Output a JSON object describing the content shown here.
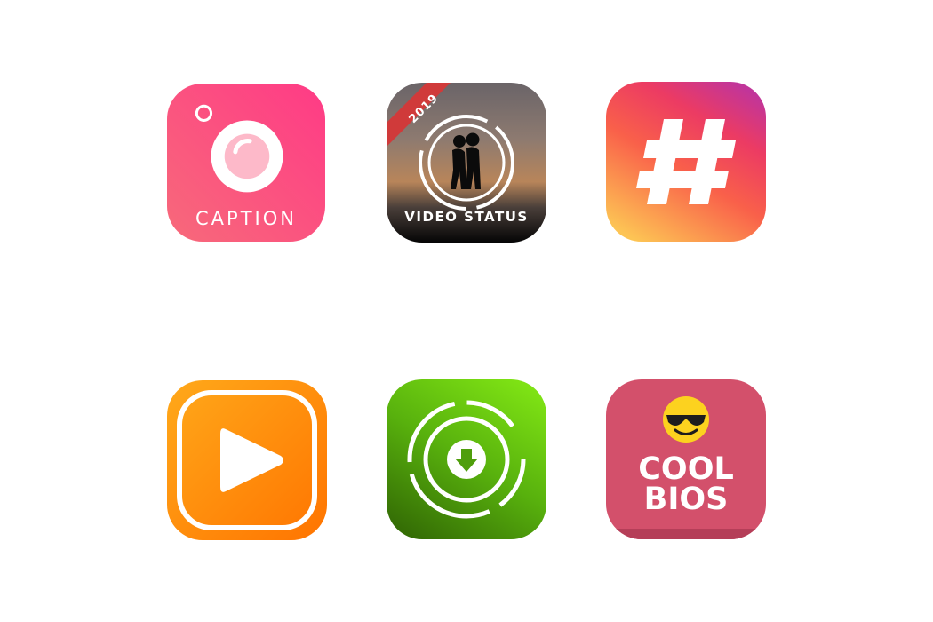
{
  "apps": {
    "caption": {
      "label": "CAPTION",
      "icon": "camera-icon",
      "colors": [
        "#f7677b",
        "#ff3d86"
      ]
    },
    "video_status": {
      "label": "VIDEO STATUS",
      "ribbon": "2019",
      "icon": "couple-silhouette-icon",
      "colors": [
        "#7a6a62",
        "#0a0a0a"
      ]
    },
    "hashtag": {
      "icon": "hashtag-icon",
      "colors": [
        "#c13584",
        "#fd7f3c",
        "#fcb045"
      ]
    },
    "video_player": {
      "icon": "play-icon",
      "colors": [
        "#ffa116",
        "#ff7b00"
      ]
    },
    "downloader": {
      "icon": "download-icon",
      "colors": [
        "#78dd12",
        "#3f7c07"
      ]
    },
    "cool_bios": {
      "line1": "COOL",
      "line2": "BIOS",
      "icon": "sunglasses-emoji-icon",
      "colors": [
        "#d65470",
        "#c4405f"
      ]
    }
  }
}
